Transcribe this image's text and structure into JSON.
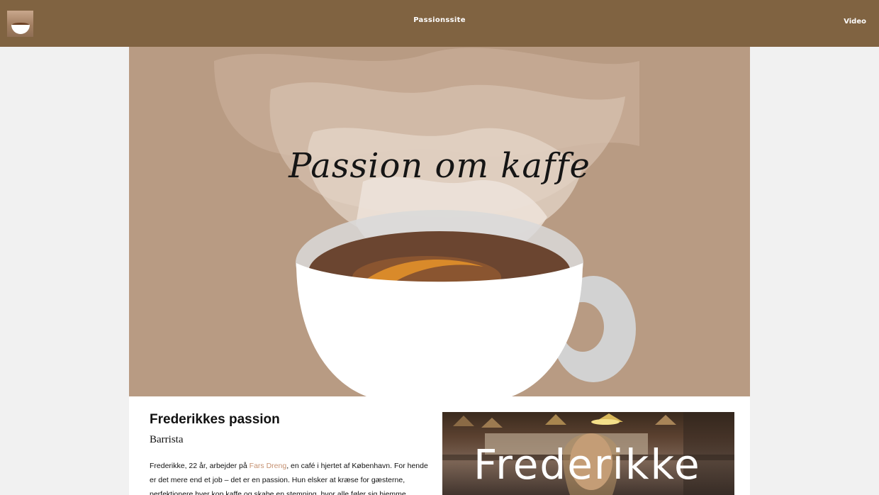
{
  "header": {
    "site_title": "Passionssite",
    "nav_video": "Video",
    "logo_icon": "coffee-cup-logo",
    "background": "#806341"
  },
  "hero": {
    "title": "Passion om kaffe",
    "background": "#b89b83"
  },
  "profile": {
    "heading": "Frederikkes passion",
    "role": "Barrista",
    "bio_part1": "Frederikke, 22 år, arbejder på ",
    "bio_link": "Fars Dreng",
    "bio_part2": ", en café i hjertet af København. For hende er det mere end et job – det er en passion. Hun elsker at kræse for gæsterne, perfektionere hver kop kaffe og skabe en stemning, hvor alle føler sig hjemme.",
    "photo_caption": "Frederikke",
    "link_color": "#c59070"
  }
}
